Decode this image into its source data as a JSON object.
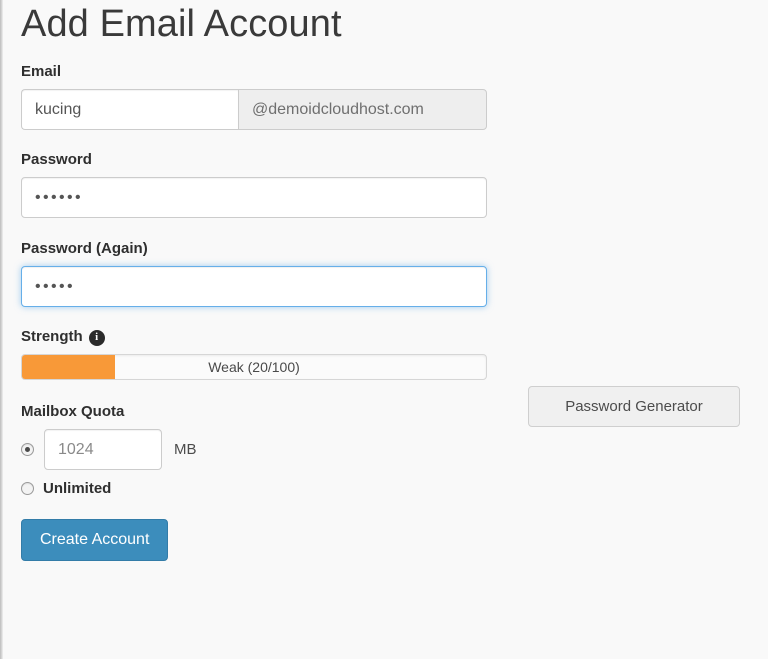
{
  "page": {
    "title": "Add Email Account"
  },
  "email": {
    "label": "Email",
    "local_value": "kucing",
    "local_placeholder": "",
    "domain_addon": "@demoidcloudhost.com"
  },
  "password": {
    "label": "Password",
    "value": "••••••",
    "placeholder": ""
  },
  "password_again": {
    "label": "Password (Again)",
    "value": "•••••",
    "placeholder": "",
    "focused": true
  },
  "strength": {
    "label": "Strength",
    "info_icon": "info-icon",
    "text": "Weak (20/100)",
    "score": 20,
    "max": 100,
    "percent": "20%",
    "fill_color": "#f89938"
  },
  "generator": {
    "label": "Password Generator"
  },
  "quota": {
    "label": "Mailbox Quota",
    "value": "1024",
    "placeholder": "1024",
    "unit": "MB",
    "selected": "sized",
    "unlimited_label": "Unlimited"
  },
  "submit": {
    "label": "Create Account",
    "color": "#3c8dbc"
  }
}
